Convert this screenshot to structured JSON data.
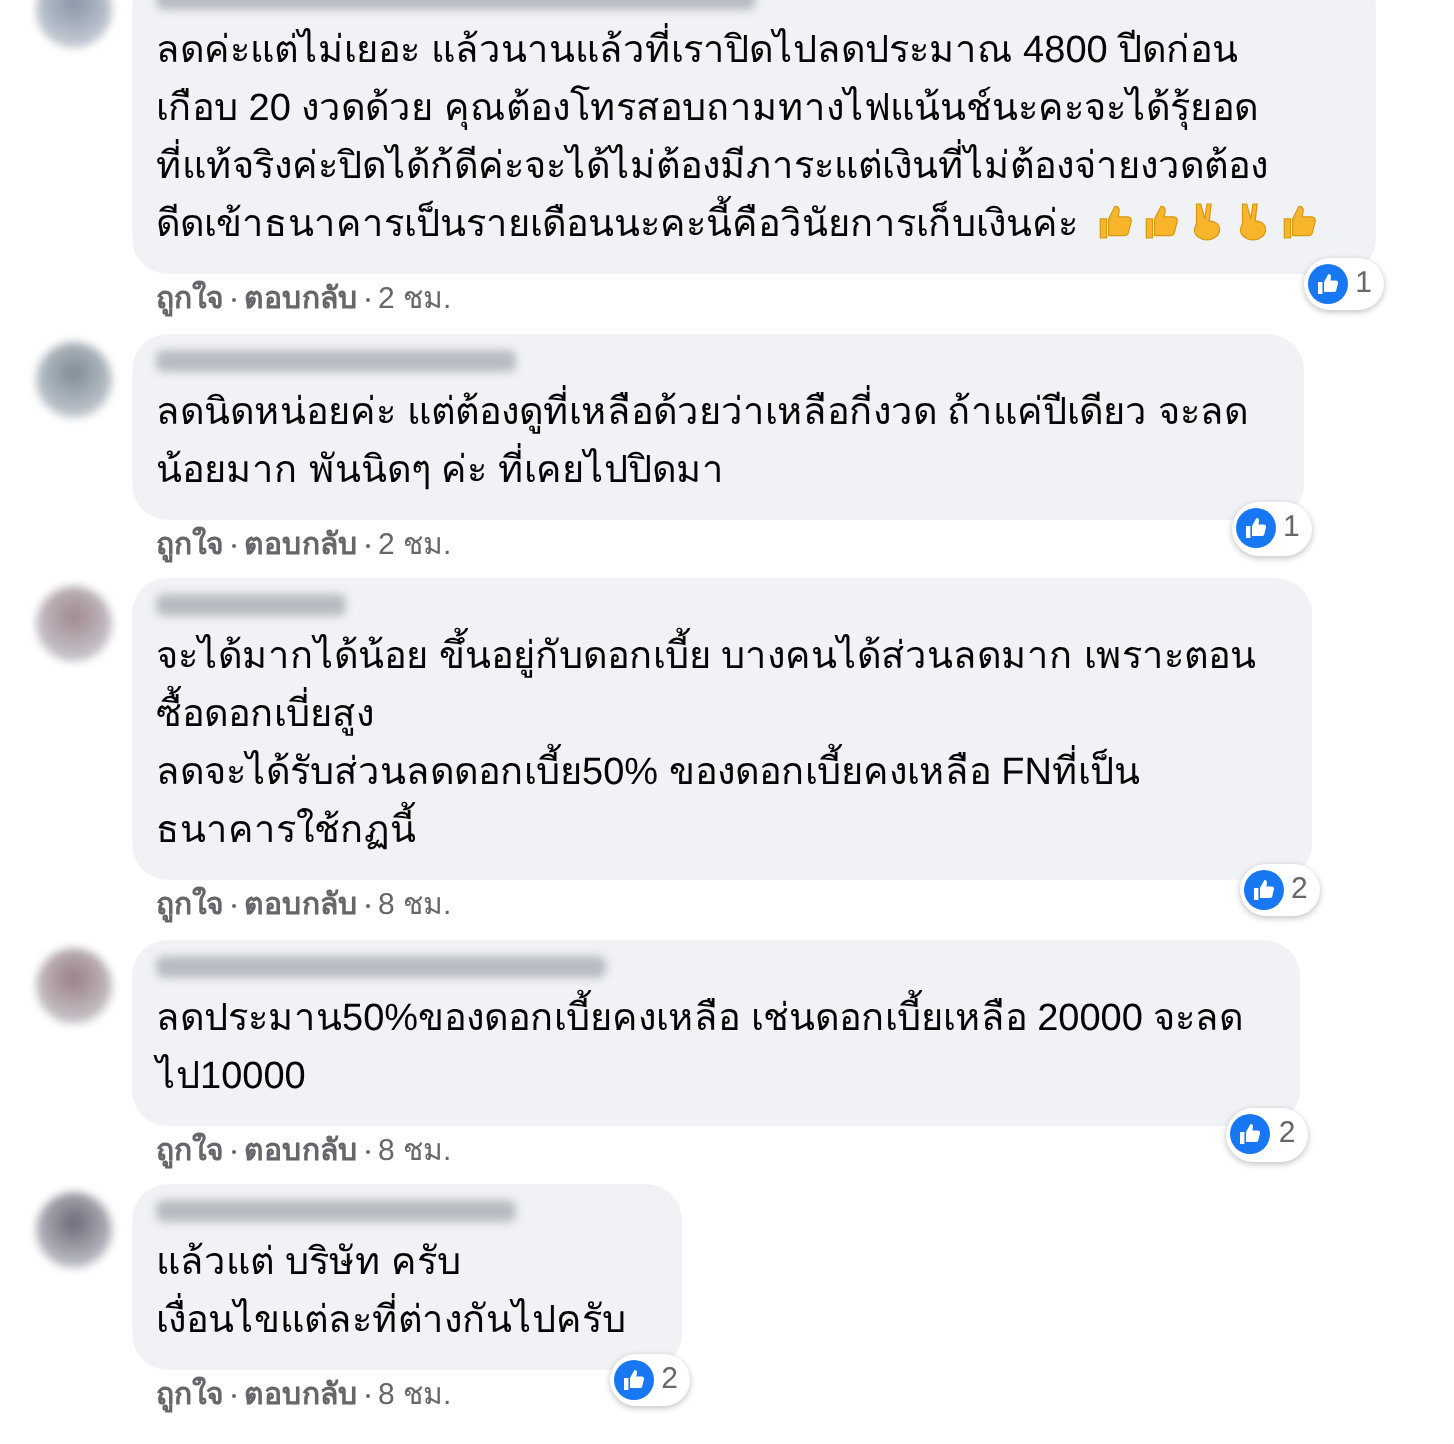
{
  "comments": [
    {
      "lines": [
        "ลดค่ะแต่ไม่เยอะ แล้วนานแล้วที่เราปิดไปลดประมาณ 4800 ปีดก่อน",
        "เกือบ 20 งวดด้วย คุณต้องโทรสอบถามทางไฟแน้นช์นะคะจะได้รุ้ยอด",
        "ที่แท้จริงค่ะปิดได้ก้ดีค่ะจะได้ไม่ต้องมีภาระแต่เงินที่ไม่ต้องจ่ายงวดต้อง",
        "ดีดเข้าธนาคารเป็นรายเดือนนะคะนี้คือวินัยการเก็บเงินค่ะ"
      ],
      "emojis": [
        {
          "kind": "thumbs-up"
        },
        {
          "kind": "thumbs-up"
        },
        {
          "kind": "victory"
        },
        {
          "kind": "victory"
        },
        {
          "kind": "thumbs-up"
        }
      ],
      "reactions": "1",
      "like": "ถูกใจ",
      "reply": "ตอบกลับ",
      "time": "2 ชม."
    },
    {
      "lines": [
        "ลดนิดหน่อยค่ะ แต่ต้องดูที่เหลือด้วยว่าเหลือกี่งวด ถ้าแค่ปีเดียว จะลด",
        "น้อยมาก พันนิดๆ ค่ะ ที่เคยไปปิดมา"
      ],
      "reactions": "1",
      "like": "ถูกใจ",
      "reply": "ตอบกลับ",
      "time": "2 ชม."
    },
    {
      "lines": [
        "จะได้มากได้น้อย ขึ้นอยู่กับดอกเบี้ย บางคนได้ส่วนลดมาก เพราะตอน",
        "ซื้อดอกเบี่ยสูง",
        "ลดจะได้รับส่วนลดดอกเบี้ย50% ของดอกเบี้ยคงเหลือ FNที่เป็น",
        "ธนาคารใช้กฏนี้"
      ],
      "reactions": "2",
      "like": "ถูกใจ",
      "reply": "ตอบกลับ",
      "time": "8 ชม."
    },
    {
      "lines": [
        "ลดประมาน50%ของดอกเบี้ยคงเหลือ เช่นดอกเบี้ยเหลือ 20000 จะลด",
        "ไป10000"
      ],
      "reactions": "2",
      "like": "ถูกใจ",
      "reply": "ตอบกลับ",
      "time": "8 ชม."
    },
    {
      "lines": [
        "แล้วแต่ บริษัท ครับ",
        "เงื่อนไขแต่ละที่ต่างกันไปครับ"
      ],
      "reactions": "2",
      "like": "ถูกใจ",
      "reply": "ตอบกลับ",
      "time": "8 ชม."
    }
  ]
}
